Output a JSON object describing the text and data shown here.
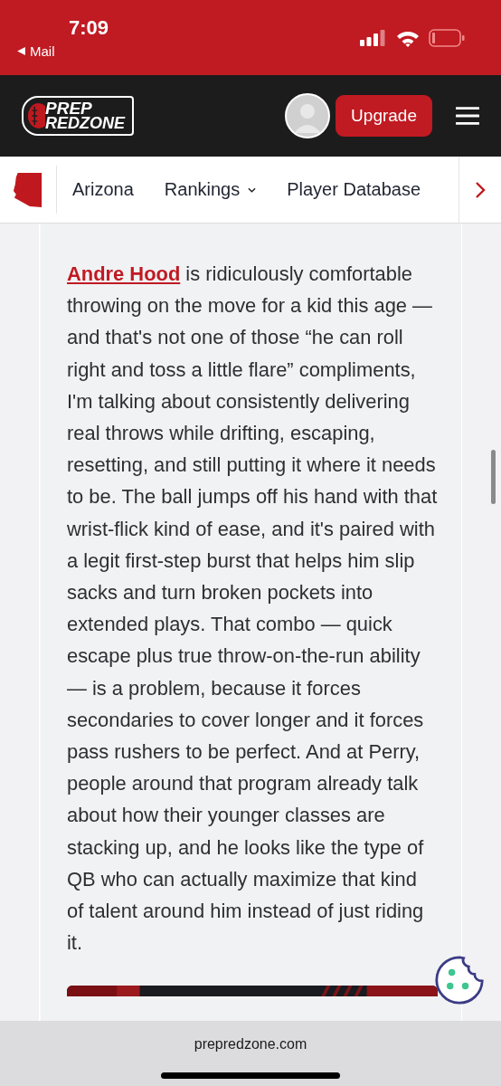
{
  "status_bar": {
    "time": "7:09",
    "back_label": "Mail"
  },
  "header": {
    "logo": {
      "line_1": "PREP",
      "line_2": "REDZONE"
    },
    "upgrade_button": "Upgrade"
  },
  "nav": {
    "items": [
      {
        "label": "Arizona",
        "dropdown": false
      },
      {
        "label": "Rankings",
        "dropdown": true
      },
      {
        "label": "Player Database",
        "dropdown": false
      }
    ]
  },
  "article": {
    "link": "Andre Hood",
    "text": " is ridiculously comfortable throwing on the move for a kid this age — and that's not one of those “he can roll right and toss a little flare” compliments, I'm talking about consistently delivering real throws while drifting, escaping, resetting, and still putting it where it needs to be. The ball jumps off his hand with that wrist-flick kind of ease, and it's paired with a legit first-step burst that helps him slip sacks and turn broken pockets into extended plays. That combo — quick escape plus true throw-on-the-run ability — is a problem, because it forces secondaries to cover longer and it forces pass rushers to be perfect. And at Perry, people around that program already talk about how their younger classes are stacking up, and he looks like the type of QB who can actually maximize that kind of talent around him instead of just riding it."
  },
  "browser": {
    "url": "prepredzone.com"
  }
}
